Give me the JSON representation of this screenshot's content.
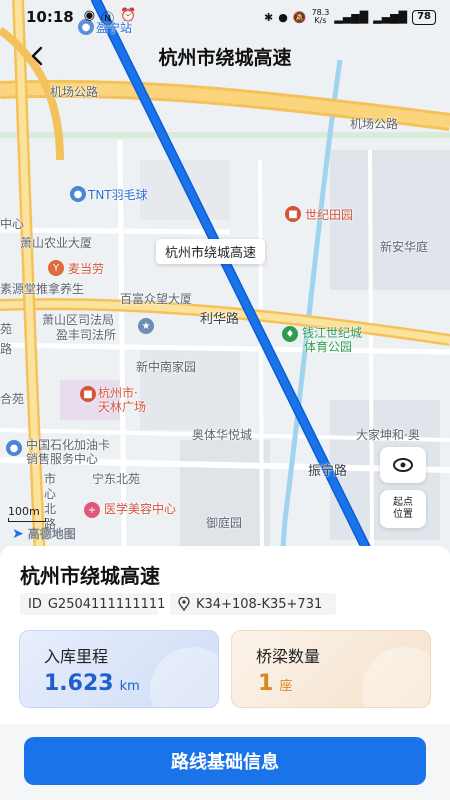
{
  "status_bar": {
    "time": "10:18",
    "network_speed_value": "78.3",
    "network_speed_unit": "K/s",
    "battery": "78"
  },
  "header": {
    "title": "杭州市绕城高速",
    "back_icon": "chevron-left-icon"
  },
  "map": {
    "route_tag": "杭州市绕城高速",
    "roads": [
      "机场公路",
      "机场公路",
      "利华路",
      "振宁路"
    ],
    "labels": [
      {
        "text": "盈宁站",
        "type": "transit"
      },
      {
        "text": "TNT羽毛球",
        "type": "poi-blue"
      },
      {
        "text": "世纪田园",
        "type": "poi-red"
      },
      {
        "text": "中心",
        "type": "area"
      },
      {
        "text": "萧山农业大厦",
        "type": "area"
      },
      {
        "text": "新安华庭",
        "type": "area"
      },
      {
        "text": "麦当劳",
        "type": "poi-red"
      },
      {
        "text": "素源堂推拿养生",
        "type": "area"
      },
      {
        "text": "百富众望大厦",
        "type": "area"
      },
      {
        "text": "萧山区司法局",
        "type": "area"
      },
      {
        "text": "盈丰司法所",
        "type": "area"
      },
      {
        "text": "钱江世纪城",
        "type": "poi-green"
      },
      {
        "text": "体育公园",
        "type": "poi-green"
      },
      {
        "text": "新中南家园",
        "type": "area"
      },
      {
        "text": "杭州市·",
        "type": "poi-red"
      },
      {
        "text": "天林广场",
        "type": "poi-red"
      },
      {
        "text": "奥体华悦城",
        "type": "area"
      },
      {
        "text": "大家坤和·奥",
        "type": "area"
      },
      {
        "text": "中国石化加油卡",
        "type": "area"
      },
      {
        "text": "销售服务中心",
        "type": "area"
      },
      {
        "text": "宁东北苑",
        "type": "area"
      },
      {
        "text": "医学美容中心",
        "type": "poi-red"
      },
      {
        "text": "御庭园",
        "type": "area"
      },
      {
        "text": "苑",
        "type": "area"
      },
      {
        "text": "路",
        "type": "area"
      },
      {
        "text": "合苑",
        "type": "area"
      },
      {
        "text": "市",
        "type": "area"
      },
      {
        "text": "心",
        "type": "area"
      },
      {
        "text": "北",
        "type": "area"
      },
      {
        "text": "路",
        "type": "area"
      }
    ],
    "scale": "100m",
    "provider": "高德地图",
    "locate_icon": "locate-target-icon",
    "start_button": "起点\n位置",
    "start_line1": "起点",
    "start_line2": "位置",
    "route_color": "#1a73e8"
  },
  "detail": {
    "road_name": "杭州市绕城高速",
    "id_label": "ID",
    "id_value": "G2504111111111",
    "range": "K34+108-K35+731",
    "mileage_label": "入库里程",
    "mileage_value": "1.623",
    "mileage_unit": "km",
    "bridge_label": "桥梁数量",
    "bridge_value": "1",
    "bridge_unit": "座",
    "primary_button": "路线基础信息"
  },
  "colors": {
    "accent": "#1a73e8",
    "mileage": "#1f5fce",
    "bridge": "#d98a1c"
  }
}
